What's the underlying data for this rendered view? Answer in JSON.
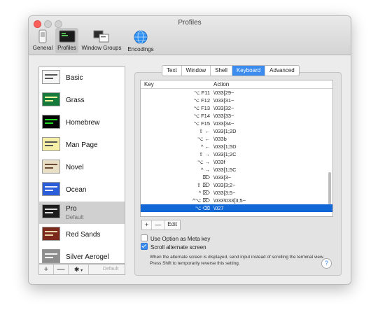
{
  "window": {
    "title": "Profiles"
  },
  "toolbar": {
    "general": "General",
    "profiles": "Profiles",
    "window_groups": "Window Groups",
    "encodings": "Encodings"
  },
  "profiles": [
    {
      "name": "Basic",
      "subtitle": ""
    },
    {
      "name": "Grass",
      "subtitle": ""
    },
    {
      "name": "Homebrew",
      "subtitle": ""
    },
    {
      "name": "Man Page",
      "subtitle": ""
    },
    {
      "name": "Novel",
      "subtitle": ""
    },
    {
      "name": "Ocean",
      "subtitle": ""
    },
    {
      "name": "Pro",
      "subtitle": "Default"
    },
    {
      "name": "Red Sands",
      "subtitle": ""
    },
    {
      "name": "Silver Aerogel",
      "subtitle": ""
    }
  ],
  "list_bar": {
    "add": "+",
    "remove": "—",
    "gear": "✱",
    "default": "Default"
  },
  "tabs": [
    "Text",
    "Window",
    "Shell",
    "Keyboard",
    "Advanced"
  ],
  "key_table": {
    "headers": {
      "key": "Key",
      "action": "Action"
    },
    "rows": [
      {
        "key": "⌥ F11",
        "action": "\\033[29~"
      },
      {
        "key": "⌥ F12",
        "action": "\\033[31~"
      },
      {
        "key": "⌥ F13",
        "action": "\\033[32~"
      },
      {
        "key": "⌥ F14",
        "action": "\\033[33~"
      },
      {
        "key": "⌥ F15",
        "action": "\\033[34~"
      },
      {
        "key": "⇧ ←",
        "action": "\\033[1;2D"
      },
      {
        "key": "⌥ ←",
        "action": "\\033b"
      },
      {
        "key": "^ ←",
        "action": "\\033[1;5D"
      },
      {
        "key": "⇧ →",
        "action": "\\033[1;2C"
      },
      {
        "key": "⌥ →",
        "action": "\\033f"
      },
      {
        "key": "^ →",
        "action": "\\033[1;5C"
      },
      {
        "key": "⌦",
        "action": "\\033[3~"
      },
      {
        "key": "⇧ ⌦",
        "action": "\\033[3;2~"
      },
      {
        "key": "^ ⌦",
        "action": "\\033[3;5~"
      },
      {
        "key": "^⌥ ⌦",
        "action": "\\033\\033[3;5~"
      },
      {
        "key": "⌥ ⌫",
        "action": "\\027"
      }
    ]
  },
  "edit_bar": {
    "add": "+",
    "remove": "—",
    "edit": "Edit"
  },
  "options": {
    "meta_key": {
      "label": "Use Option as Meta key",
      "checked": false
    },
    "scroll_alt": {
      "label": "Scroll alternate screen",
      "checked": true
    }
  },
  "help_text": "When the alternate screen is displayed, send input instead of scrolling the terminal view. Press Shift to temporarily reverse this setting.",
  "help_button": "?",
  "colors": {
    "accent": "#3c8cf0",
    "selection": "#1167d5",
    "close": "#fc605c"
  }
}
